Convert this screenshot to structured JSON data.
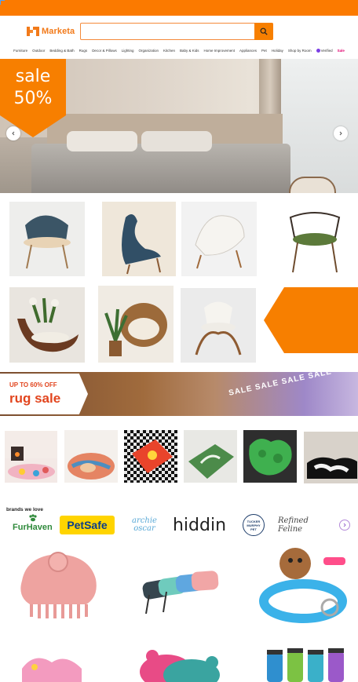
{
  "header": {
    "brand_name": "Marketa",
    "search_placeholder": "",
    "colors": {
      "accent": "#f77f00",
      "brand_text": "#f27a1a"
    }
  },
  "nav": {
    "items": [
      "Furniture",
      "Outdoor",
      "Bedding & Bath",
      "Rugs",
      "Decor & Pillows",
      "Lighting",
      "Organization",
      "Kitchen",
      "Baby & Kids",
      "Home Improvement",
      "Appliances",
      "Pet",
      "Holiday",
      "Shop by Room"
    ],
    "verified_label": "Verified",
    "sale_label": "Sale"
  },
  "hero": {
    "badge_line1": "sale",
    "badge_line2": "50%",
    "prev_icon": "chevron-left-icon",
    "next_icon": "chevron-right-icon"
  },
  "chairs": {
    "row1": [
      "blue lounge chair",
      "blue sculpted chair",
      "white leaf chair",
      "green armchair"
    ],
    "row2": [
      "crescent plant chair",
      "wicker egg chair",
      "white curved chair"
    ]
  },
  "rug_banner": {
    "line1": "UP TO 60% OFF",
    "line2": "rug sale",
    "overlay": "SALE SALE SALE SALE"
  },
  "rugs": {
    "items": [
      "living room rug",
      "round abstract rug",
      "checkered rug",
      "green leaf rug",
      "green puzzle rug",
      "black white rug"
    ]
  },
  "brands": {
    "title": "brands we love",
    "items": [
      "FurHaven",
      "PetSafe",
      "archie oscar",
      "hiddin",
      "TUCKER MURPHY PET",
      "Refined Feline"
    ]
  },
  "pet_products": {
    "items": [
      "pink paw brush",
      "retractable leashes",
      "LED dog collar",
      "pink toy",
      "paw mat",
      "water bottles"
    ]
  }
}
